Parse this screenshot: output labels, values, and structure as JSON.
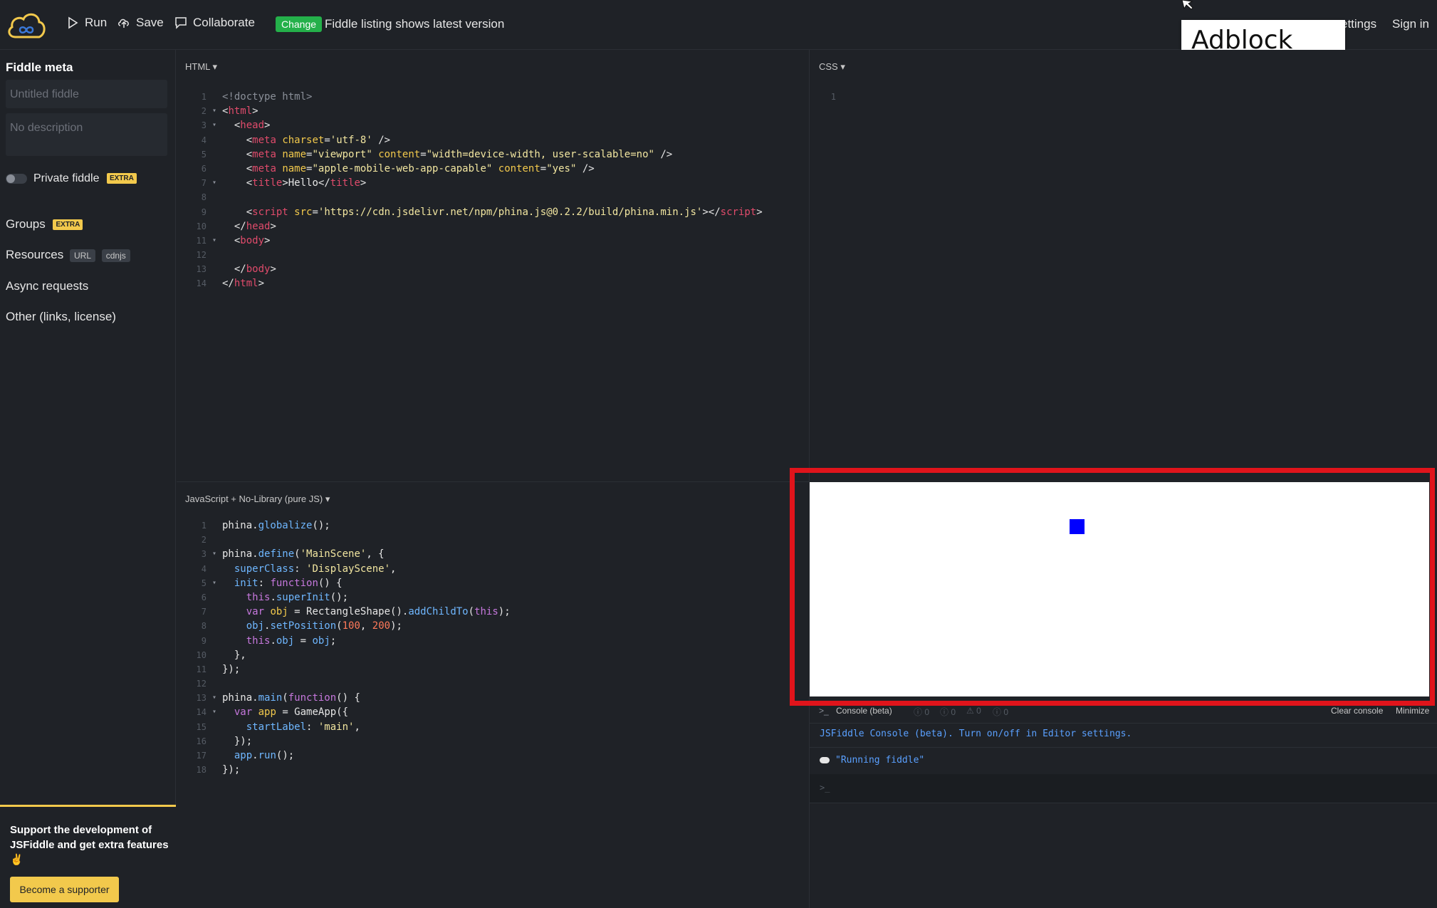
{
  "topbar": {
    "run_label": "Run",
    "save_label": "Save",
    "collaborate_label": "Collaborate",
    "change_badge": "Change",
    "change_text": "Fiddle listing shows latest version",
    "settings_label": "ettings",
    "signin_label": "Sign in"
  },
  "overlay": {
    "adblock_label": "Adblock Plus"
  },
  "sidebar": {
    "title": "Fiddle meta",
    "title_placeholder": "Untitled fiddle",
    "description_placeholder": "No description",
    "private_label": "Private fiddle",
    "extra_badge": "EXTRA",
    "groups_label": "Groups",
    "resources_label": "Resources",
    "url_badge": "URL",
    "cdnjs_badge": "cdnjs",
    "async_label": "Async requests",
    "other_label": "Other (links, license)",
    "support_text": "Support the development of JSFiddle and get extra features ✌",
    "support_button": "Become a supporter"
  },
  "panels": {
    "html_title": "HTML ▾",
    "css_title": "CSS ▾",
    "js_title": "JavaScript + No-Library (pure JS) ▾"
  },
  "html_code": [
    {
      "n": "1",
      "f": "",
      "segs": [
        [
          "c-doc",
          "<!doctype html>"
        ]
      ]
    },
    {
      "n": "2",
      "f": "▾",
      "segs": [
        [
          "txt",
          "<"
        ],
        [
          "c-tag",
          "html"
        ],
        [
          "txt",
          ">"
        ]
      ]
    },
    {
      "n": "3",
      "f": "▾",
      "segs": [
        [
          "txt",
          "  <"
        ],
        [
          "c-tag",
          "head"
        ],
        [
          "txt",
          ">"
        ]
      ]
    },
    {
      "n": "4",
      "f": "",
      "segs": [
        [
          "txt",
          "    <"
        ],
        [
          "c-tag",
          "meta"
        ],
        [
          "txt",
          " "
        ],
        [
          "c-attr",
          "charset"
        ],
        [
          "txt",
          "="
        ],
        [
          "c-str",
          "'utf-8'"
        ],
        [
          "txt",
          " />"
        ]
      ]
    },
    {
      "n": "5",
      "f": "",
      "segs": [
        [
          "txt",
          "    <"
        ],
        [
          "c-tag",
          "meta"
        ],
        [
          "txt",
          " "
        ],
        [
          "c-attr",
          "name"
        ],
        [
          "txt",
          "="
        ],
        [
          "c-str",
          "\"viewport\""
        ],
        [
          "txt",
          " "
        ],
        [
          "c-attr",
          "content"
        ],
        [
          "txt",
          "="
        ],
        [
          "c-str",
          "\"width=device-width, user-scalable=no\""
        ],
        [
          "txt",
          " />"
        ]
      ]
    },
    {
      "n": "6",
      "f": "",
      "segs": [
        [
          "txt",
          "    <"
        ],
        [
          "c-tag",
          "meta"
        ],
        [
          "txt",
          " "
        ],
        [
          "c-attr",
          "name"
        ],
        [
          "txt",
          "="
        ],
        [
          "c-str",
          "\"apple-mobile-web-app-capable\""
        ],
        [
          "txt",
          " "
        ],
        [
          "c-attr",
          "content"
        ],
        [
          "txt",
          "="
        ],
        [
          "c-str",
          "\"yes\""
        ],
        [
          "txt",
          " />"
        ]
      ]
    },
    {
      "n": "7",
      "f": "▾",
      "segs": [
        [
          "txt",
          "    <"
        ],
        [
          "c-tag",
          "title"
        ],
        [
          "txt",
          ">Hello</"
        ],
        [
          "c-tag",
          "title"
        ],
        [
          "txt",
          ">"
        ]
      ]
    },
    {
      "n": "8",
      "f": "",
      "segs": [
        [
          "txt",
          ""
        ]
      ]
    },
    {
      "n": "9",
      "f": "",
      "segs": [
        [
          "txt",
          "    <"
        ],
        [
          "c-tag",
          "script"
        ],
        [
          "txt",
          " "
        ],
        [
          "c-attr",
          "src"
        ],
        [
          "txt",
          "="
        ],
        [
          "c-str",
          "'https://cdn.jsdelivr.net/npm/phina.js@0.2.2/build/phina.min.js'"
        ],
        [
          "txt",
          "></"
        ],
        [
          "c-tag",
          "script"
        ],
        [
          "txt",
          ">"
        ]
      ]
    },
    {
      "n": "10",
      "f": "",
      "segs": [
        [
          "txt",
          "  </"
        ],
        [
          "c-tag",
          "head"
        ],
        [
          "txt",
          ">"
        ]
      ]
    },
    {
      "n": "11",
      "f": "▾",
      "segs": [
        [
          "txt",
          "  <"
        ],
        [
          "c-tag",
          "body"
        ],
        [
          "txt",
          ">"
        ]
      ]
    },
    {
      "n": "12",
      "f": "",
      "segs": [
        [
          "txt",
          ""
        ]
      ]
    },
    {
      "n": "13",
      "f": "",
      "segs": [
        [
          "txt",
          "  </"
        ],
        [
          "c-tag",
          "body"
        ],
        [
          "txt",
          ">"
        ]
      ]
    },
    {
      "n": "14",
      "f": "",
      "segs": [
        [
          "txt",
          "</"
        ],
        [
          "c-tag",
          "html"
        ],
        [
          "txt",
          ">"
        ]
      ]
    }
  ],
  "css_code": [
    {
      "n": "1",
      "f": "",
      "segs": [
        [
          "txt",
          ""
        ]
      ]
    }
  ],
  "js_code": [
    {
      "n": "1",
      "f": "",
      "segs": [
        [
          "txt",
          "phina."
        ],
        [
          "c-prop",
          "globalize"
        ],
        [
          "txt",
          "();"
        ]
      ]
    },
    {
      "n": "2",
      "f": "",
      "segs": [
        [
          "txt",
          ""
        ]
      ]
    },
    {
      "n": "3",
      "f": "▾",
      "segs": [
        [
          "txt",
          "phina."
        ],
        [
          "c-prop",
          "define"
        ],
        [
          "txt",
          "("
        ],
        [
          "c-str",
          "'MainScene'"
        ],
        [
          "txt",
          ", {"
        ]
      ]
    },
    {
      "n": "4",
      "f": "",
      "segs": [
        [
          "txt",
          "  "
        ],
        [
          "c-prop",
          "superClass"
        ],
        [
          "txt",
          ": "
        ],
        [
          "c-str",
          "'DisplayScene'"
        ],
        [
          "txt",
          ","
        ]
      ]
    },
    {
      "n": "5",
      "f": "▾",
      "segs": [
        [
          "txt",
          "  "
        ],
        [
          "c-prop",
          "init"
        ],
        [
          "txt",
          ": "
        ],
        [
          "c-kw",
          "function"
        ],
        [
          "txt",
          "() {"
        ]
      ]
    },
    {
      "n": "6",
      "f": "",
      "segs": [
        [
          "txt",
          "    "
        ],
        [
          "c-kw",
          "this"
        ],
        [
          "txt",
          "."
        ],
        [
          "c-prop",
          "superInit"
        ],
        [
          "txt",
          "();"
        ]
      ]
    },
    {
      "n": "7",
      "f": "",
      "segs": [
        [
          "txt",
          "    "
        ],
        [
          "c-kw",
          "var"
        ],
        [
          "txt",
          " "
        ],
        [
          "c-attr",
          "obj"
        ],
        [
          "txt",
          " = RectangleShape()."
        ],
        [
          "c-prop",
          "addChildTo"
        ],
        [
          "txt",
          "("
        ],
        [
          "c-kw",
          "this"
        ],
        [
          "txt",
          ");"
        ]
      ]
    },
    {
      "n": "8",
      "f": "",
      "segs": [
        [
          "txt",
          "    "
        ],
        [
          "c-prop",
          "obj"
        ],
        [
          "txt",
          "."
        ],
        [
          "c-prop",
          "setPosition"
        ],
        [
          "txt",
          "("
        ],
        [
          "c-num",
          "100"
        ],
        [
          "txt",
          ", "
        ],
        [
          "c-num",
          "200"
        ],
        [
          "txt",
          ");"
        ]
      ]
    },
    {
      "n": "9",
      "f": "",
      "segs": [
        [
          "txt",
          "    "
        ],
        [
          "c-kw",
          "this"
        ],
        [
          "txt",
          "."
        ],
        [
          "c-prop",
          "obj"
        ],
        [
          "txt",
          " = "
        ],
        [
          "c-prop",
          "obj"
        ],
        [
          "txt",
          ";"
        ]
      ]
    },
    {
      "n": "10",
      "f": "",
      "segs": [
        [
          "txt",
          "  },"
        ]
      ]
    },
    {
      "n": "11",
      "f": "",
      "segs": [
        [
          "txt",
          "});"
        ]
      ]
    },
    {
      "n": "12",
      "f": "",
      "segs": [
        [
          "txt",
          ""
        ]
      ]
    },
    {
      "n": "13",
      "f": "▾",
      "segs": [
        [
          "txt",
          "phina."
        ],
        [
          "c-prop",
          "main"
        ],
        [
          "txt",
          "("
        ],
        [
          "c-kw",
          "function"
        ],
        [
          "txt",
          "() {"
        ]
      ]
    },
    {
      "n": "14",
      "f": "▾",
      "segs": [
        [
          "txt",
          "  "
        ],
        [
          "c-kw",
          "var"
        ],
        [
          "txt",
          " "
        ],
        [
          "c-attr",
          "app"
        ],
        [
          "txt",
          " = GameApp({"
        ]
      ]
    },
    {
      "n": "15",
      "f": "",
      "segs": [
        [
          "txt",
          "    "
        ],
        [
          "c-prop",
          "startLabel"
        ],
        [
          "txt",
          ": "
        ],
        [
          "c-str",
          "'main'"
        ],
        [
          "txt",
          ","
        ]
      ]
    },
    {
      "n": "16",
      "f": "",
      "segs": [
        [
          "txt",
          "  });"
        ]
      ]
    },
    {
      "n": "17",
      "f": "",
      "segs": [
        [
          "txt",
          "  "
        ],
        [
          "c-prop",
          "app"
        ],
        [
          "txt",
          "."
        ],
        [
          "c-prop",
          "run"
        ],
        [
          "txt",
          "();"
        ]
      ]
    },
    {
      "n": "18",
      "f": "",
      "segs": [
        [
          "txt",
          "});"
        ]
      ]
    }
  ],
  "console": {
    "title": "Console (beta)",
    "counts": [
      "0",
      "0",
      "0",
      "0"
    ],
    "clear_label": "Clear console",
    "minimize_label": "Minimize",
    "info_message": "JSFiddle Console (beta). Turn on/off in Editor settings.",
    "log_message": "\"Running fiddle\"",
    "prompt": ">_"
  },
  "colors": {
    "accent_green": "#24b04a",
    "extra_yellow": "#f2c94c",
    "highlight_red": "#e0141b",
    "result_square": "#0000ff"
  }
}
